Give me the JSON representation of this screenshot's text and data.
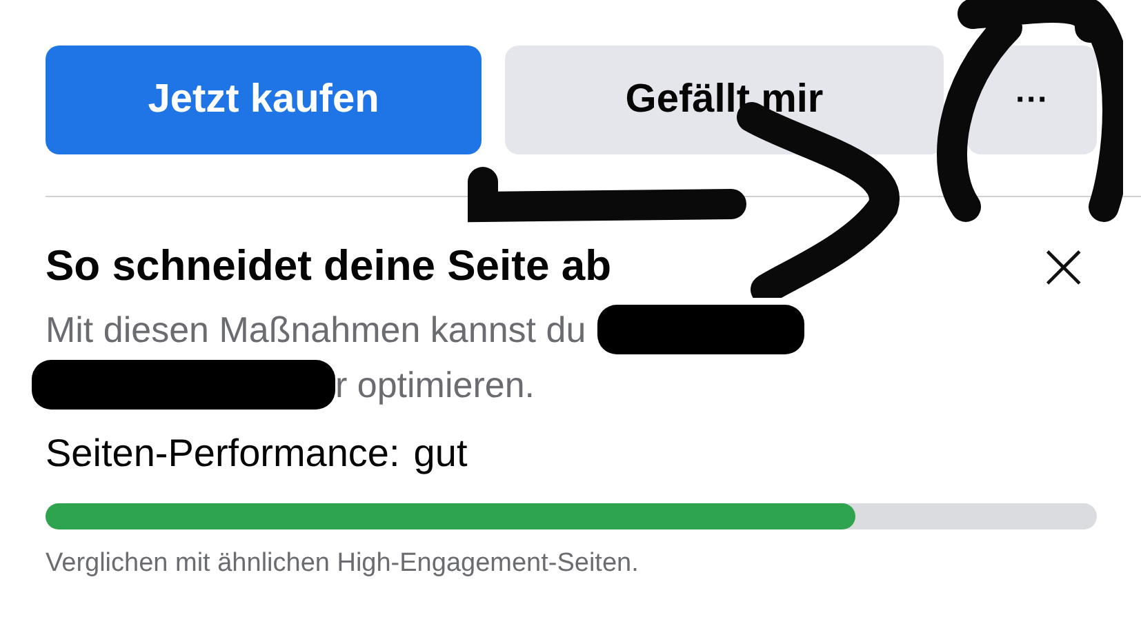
{
  "actions": [
    {
      "label": "Jetzt kaufen",
      "kind": "primary"
    },
    {
      "label": "Gefällt mir",
      "kind": "secondary"
    },
    {
      "label": "···",
      "kind": "more"
    }
  ],
  "card": {
    "title": "So schneidet deine Seite ab",
    "close": "×",
    "description_line_1": "Mit diesen Maßnahmen kannst du",
    "description_line_2": "r optimieren.",
    "performance_label": "Seiten-Performance:",
    "performance_value": "gut",
    "level": 0.77,
    "footnote": "Verglichen mit ähnlichen High-Engagement-Seiten."
  }
}
